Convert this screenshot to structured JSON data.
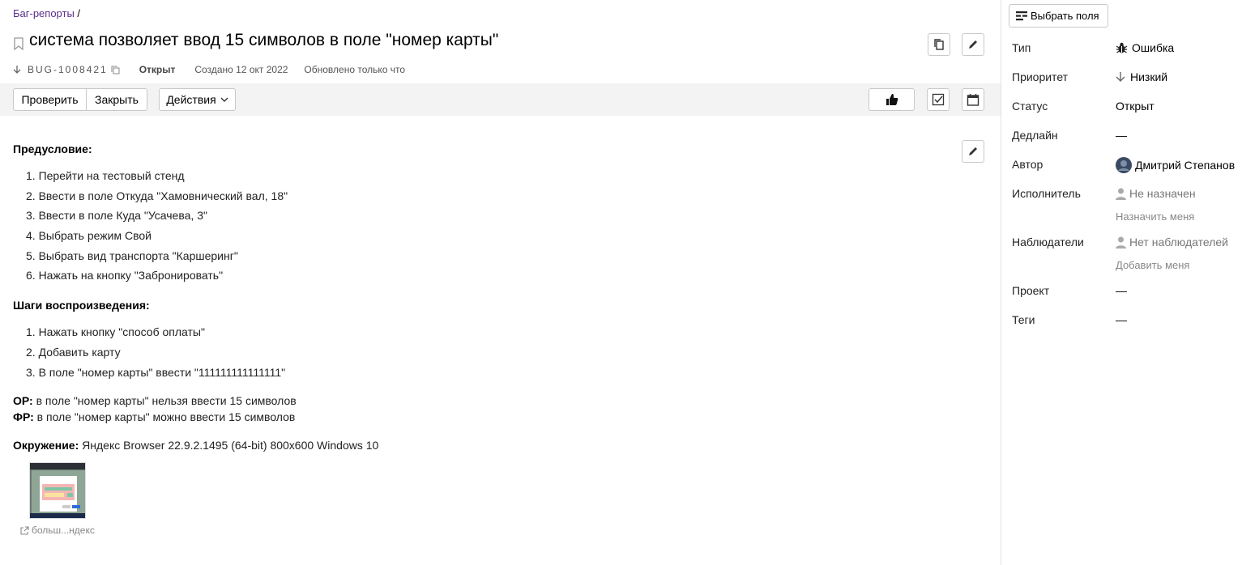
{
  "breadcrumb": {
    "link": "Баг-репорты",
    "sep": " /"
  },
  "issue": {
    "title": "система позволяет ввод 15 символов в поле \"номер карты\"",
    "key": "BUG-1008421",
    "status": "Открыт",
    "created": "Создано 12 окт 2022",
    "updated": "Обновлено только что"
  },
  "toolbar": {
    "check_label": "Проверить",
    "close_label": "Закрыть",
    "actions_label": "Действия"
  },
  "description": {
    "precondition_title": "Предусловие:",
    "precondition_items": [
      "1. Перейти на тестовый стенд",
      "2. Ввести в поле Откуда \"Хамовнический вал, 18\"",
      "3. Ввести в поле Куда \"Усачева, 3\"",
      "4. Выбрать режим Свой",
      "5. Выбрать вид транспорта \"Каршеринг\"",
      "6. Нажать на кнопку \"Забронировать\""
    ],
    "steps_title": "Шаги воспроизведения:",
    "steps_items": [
      "1. Нажать кнопку \"способ оплаты\"",
      "2. Добавить карту",
      "3. В поле \"номер карты\" ввести \"111111111111111\""
    ],
    "expected_label": "ОР:",
    "expected_text": " в поле \"номер карты\" нельзя ввести 15 символов",
    "actual_label": "ФР:",
    "actual_text": " в поле \"номер карты\" можно ввести 15 символов",
    "env_label": "Окружение:",
    "env_text": " Яндекс Browser 22.9.2.1495 (64-bit) 800x600 Windows 10"
  },
  "attachment": {
    "caption": "больш...ндекс"
  },
  "sidebar": {
    "choose_fields_label": "Выбрать поля",
    "type_label": "Тип",
    "type_value": "Ошибка",
    "priority_label": "Приоритет",
    "priority_value": "Низкий",
    "status_label": "Статус",
    "status_value": "Открыт",
    "deadline_label": "Дедлайн",
    "deadline_value": "—",
    "author_label": "Автор",
    "author_value": "Дмитрий Степанов",
    "assignee_label": "Исполнитель",
    "assignee_value": "Не назначен",
    "assign_me": "Назначить меня",
    "followers_label": "Наблюдатели",
    "followers_value": "Нет наблюдателей",
    "add_me": "Добавить меня",
    "project_label": "Проект",
    "project_value": "—",
    "tags_label": "Теги",
    "tags_value": "—"
  },
  "icons": [
    "bookmark-icon",
    "copy-icon",
    "pencil-icon",
    "arrow-down-icon",
    "copy-key-icon",
    "chevron-down-icon",
    "thumbs-up-icon",
    "checklist-icon",
    "calendar-icon",
    "fields-icon",
    "bug-icon",
    "user-icon",
    "external-link-icon"
  ]
}
